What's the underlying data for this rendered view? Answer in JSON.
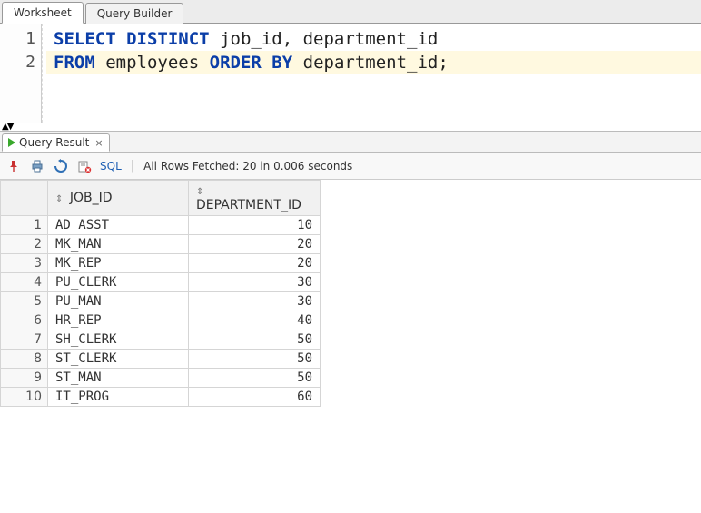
{
  "tabs": {
    "worksheet": "Worksheet",
    "query_builder": "Query Builder"
  },
  "editor": {
    "lines": [
      {
        "num": "1",
        "tokens": [
          {
            "t": "kw",
            "v": "SELECT"
          },
          {
            "t": "sp",
            "v": " "
          },
          {
            "t": "kw",
            "v": "DISTINCT"
          },
          {
            "t": "sp",
            "v": " "
          },
          {
            "t": "word",
            "v": "job_id"
          },
          {
            "t": "punct",
            "v": ","
          },
          {
            "t": "sp",
            "v": " "
          },
          {
            "t": "word",
            "v": "department_id"
          }
        ],
        "hl": false
      },
      {
        "num": "2",
        "tokens": [
          {
            "t": "kw",
            "v": "FROM"
          },
          {
            "t": "sp",
            "v": " "
          },
          {
            "t": "word",
            "v": "employees"
          },
          {
            "t": "sp",
            "v": " "
          },
          {
            "t": "kw",
            "v": "ORDER"
          },
          {
            "t": "sp",
            "v": " "
          },
          {
            "t": "kw",
            "v": "BY"
          },
          {
            "t": "sp",
            "v": " "
          },
          {
            "t": "word",
            "v": "department_id"
          },
          {
            "t": "punct",
            "v": ";"
          }
        ],
        "hl": true
      }
    ]
  },
  "result_tab": {
    "label": "Query Result",
    "close_glyph": "×"
  },
  "toolbar": {
    "sql_label": "SQL",
    "status": "All Rows Fetched: 20 in 0.006 seconds"
  },
  "grid": {
    "columns": [
      {
        "key": "JOB_ID",
        "label": "JOB_ID",
        "numeric": false
      },
      {
        "key": "DEPARTMENT_ID",
        "label": "DEPARTMENT_ID",
        "numeric": true
      }
    ],
    "rows": [
      {
        "JOB_ID": "AD_ASST",
        "DEPARTMENT_ID": "10"
      },
      {
        "JOB_ID": "MK_MAN",
        "DEPARTMENT_ID": "20"
      },
      {
        "JOB_ID": "MK_REP",
        "DEPARTMENT_ID": "20"
      },
      {
        "JOB_ID": "PU_CLERK",
        "DEPARTMENT_ID": "30"
      },
      {
        "JOB_ID": "PU_MAN",
        "DEPARTMENT_ID": "30"
      },
      {
        "JOB_ID": "HR_REP",
        "DEPARTMENT_ID": "40"
      },
      {
        "JOB_ID": "SH_CLERK",
        "DEPARTMENT_ID": "50"
      },
      {
        "JOB_ID": "ST_CLERK",
        "DEPARTMENT_ID": "50"
      },
      {
        "JOB_ID": "ST_MAN",
        "DEPARTMENT_ID": "50"
      },
      {
        "JOB_ID": "IT_PROG",
        "DEPARTMENT_ID": "60"
      }
    ]
  }
}
